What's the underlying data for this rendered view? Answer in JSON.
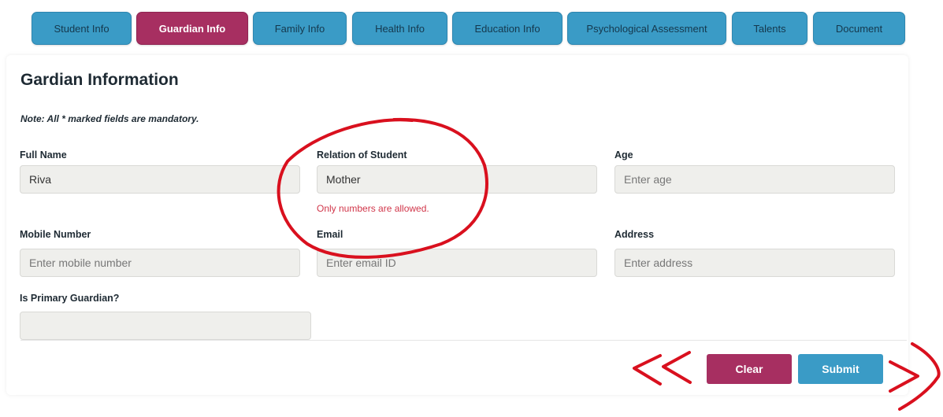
{
  "tabs": [
    {
      "label": "Student Info",
      "active": false
    },
    {
      "label": "Guardian Info",
      "active": true
    },
    {
      "label": "Family Info",
      "active": false
    },
    {
      "label": "Health Info",
      "active": false
    },
    {
      "label": "Education Info",
      "active": false
    },
    {
      "label": "Psychological Assessment",
      "active": false
    },
    {
      "label": "Talents",
      "active": false
    },
    {
      "label": "Document",
      "active": false
    }
  ],
  "form": {
    "title": "Gardian Information",
    "note": "Note: All * marked fields are mandatory.",
    "full_name": {
      "label": "Full Name",
      "value": "Riva",
      "placeholder": ""
    },
    "relation": {
      "label": "Relation of Student",
      "value": "Mother",
      "placeholder": "",
      "error": "Only numbers are allowed."
    },
    "age": {
      "label": "Age",
      "value": "",
      "placeholder": "Enter age"
    },
    "mobile": {
      "label": "Mobile Number",
      "value": "",
      "placeholder": "Enter mobile number"
    },
    "email": {
      "label": "Email",
      "value": "",
      "placeholder": "Enter email ID"
    },
    "address": {
      "label": "Address",
      "value": "",
      "placeholder": "Enter address"
    },
    "primary_guardian": {
      "label": "Is Primary Guardian?",
      "value": ""
    }
  },
  "buttons": {
    "clear": "Clear",
    "submit": "Submit"
  },
  "colors": {
    "tab": "#3a9bc6",
    "tab_active": "#a72f61",
    "error": "#d1364a",
    "annotation": "#d9101e"
  }
}
